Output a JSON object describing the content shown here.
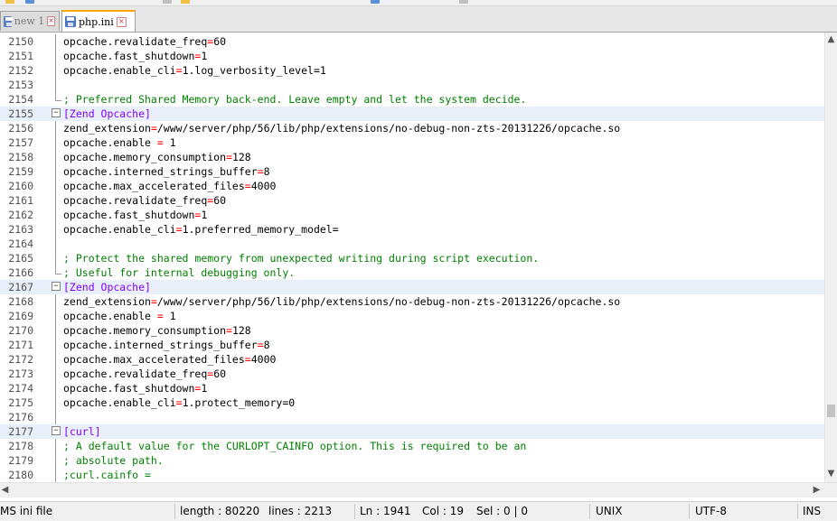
{
  "toolbar": {
    "icon_colors": [
      "#f0c040",
      "#5a8fd8",
      "#c0c0c0",
      "#f0c040",
      "#5a8fd8",
      "#c0c0c0"
    ]
  },
  "tabs": [
    {
      "label": "new 1",
      "active": false,
      "icon": "floppy-disk-icon",
      "icon_color": "#5b7fc0"
    },
    {
      "label": "php.ini",
      "active": true,
      "icon": "floppy-disk-icon",
      "icon_color": "#4a78c8"
    }
  ],
  "editor": {
    "lines": [
      {
        "n": "2150",
        "text": "opcache.revalidate_freq=60",
        "kind": "kv",
        "fold": "line"
      },
      {
        "n": "2151",
        "text": "opcache.fast_shutdown=1",
        "kind": "kv",
        "fold": "line"
      },
      {
        "n": "2152",
        "text": "opcache.enable_cli=1.log_verbosity_level=1",
        "kind": "kv",
        "fold": "line"
      },
      {
        "n": "2153",
        "text": "",
        "kind": "blank",
        "fold": "line"
      },
      {
        "n": "2154",
        "text": "; Preferred Shared Memory back-end. Leave empty and let the system decide.",
        "kind": "comment",
        "fold": "end"
      },
      {
        "n": "2155",
        "text": "[Zend Opcache]",
        "kind": "section",
        "fold": "box"
      },
      {
        "n": "2156",
        "text": "zend_extension=/www/server/php/56/lib/php/extensions/no-debug-non-zts-20131226/opcache.so",
        "kind": "kv",
        "fold": "line"
      },
      {
        "n": "2157",
        "text": "opcache.enable = 1",
        "kind": "kv",
        "fold": "line"
      },
      {
        "n": "2158",
        "text": "opcache.memory_consumption=128",
        "kind": "kv",
        "fold": "line"
      },
      {
        "n": "2159",
        "text": "opcache.interned_strings_buffer=8",
        "kind": "kv",
        "fold": "line"
      },
      {
        "n": "2160",
        "text": "opcache.max_accelerated_files=4000",
        "kind": "kv",
        "fold": "line"
      },
      {
        "n": "2161",
        "text": "opcache.revalidate_freq=60",
        "kind": "kv",
        "fold": "line"
      },
      {
        "n": "2162",
        "text": "opcache.fast_shutdown=1",
        "kind": "kv",
        "fold": "line"
      },
      {
        "n": "2163",
        "text": "opcache.enable_cli=1.preferred_memory_model=",
        "kind": "kv",
        "fold": "line"
      },
      {
        "n": "2164",
        "text": "",
        "kind": "blank",
        "fold": "line"
      },
      {
        "n": "2165",
        "text": "; Protect the shared memory from unexpected writing during script execution.",
        "kind": "comment",
        "fold": "line"
      },
      {
        "n": "2166",
        "text": "; Useful for internal debugging only.",
        "kind": "comment",
        "fold": "end"
      },
      {
        "n": "2167",
        "text": "[Zend Opcache]",
        "kind": "section",
        "fold": "box"
      },
      {
        "n": "2168",
        "text": "zend_extension=/www/server/php/56/lib/php/extensions/no-debug-non-zts-20131226/opcache.so",
        "kind": "kv",
        "fold": "line"
      },
      {
        "n": "2169",
        "text": "opcache.enable = 1",
        "kind": "kv",
        "fold": "line"
      },
      {
        "n": "2170",
        "text": "opcache.memory_consumption=128",
        "kind": "kv",
        "fold": "line"
      },
      {
        "n": "2171",
        "text": "opcache.interned_strings_buffer=8",
        "kind": "kv",
        "fold": "line"
      },
      {
        "n": "2172",
        "text": "opcache.max_accelerated_files=4000",
        "kind": "kv",
        "fold": "line"
      },
      {
        "n": "2173",
        "text": "opcache.revalidate_freq=60",
        "kind": "kv",
        "fold": "line"
      },
      {
        "n": "2174",
        "text": "opcache.fast_shutdown=1",
        "kind": "kv",
        "fold": "line"
      },
      {
        "n": "2175",
        "text": "opcache.enable_cli=1.protect_memory=0",
        "kind": "kv",
        "fold": "line"
      },
      {
        "n": "2176",
        "text": "",
        "kind": "blank",
        "fold": "line"
      },
      {
        "n": "2177",
        "text": "[curl]",
        "kind": "section",
        "fold": "box"
      },
      {
        "n": "2178",
        "text": "; A default value for the CURLOPT_CAINFO option. This is required to be an",
        "kind": "comment",
        "fold": "line"
      },
      {
        "n": "2179",
        "text": "; absolute path.",
        "kind": "comment",
        "fold": "line"
      },
      {
        "n": "2180",
        "text": ";curl.cainfo =",
        "kind": "comment",
        "fold": "line"
      }
    ],
    "colors": {
      "section": "#8000ff",
      "comment": "#008000",
      "operator": "#ff0000",
      "key": "#000000",
      "fold_header_bg": "#e9eff9"
    },
    "vertical_scroll_position": 0.9
  },
  "scrollbars": {
    "up_icon": "▲",
    "down_icon": "▼",
    "left_icon": "◀",
    "right_icon": "▶"
  },
  "statusbar": {
    "file_type": "MS ini file",
    "length": "length : 80220",
    "lines": "lines : 2213",
    "ln": "Ln : 1941",
    "col": "Col : 19",
    "sel": "Sel : 0 | 0",
    "eol": "UNIX",
    "encoding": "UTF-8",
    "mode": "INS"
  }
}
